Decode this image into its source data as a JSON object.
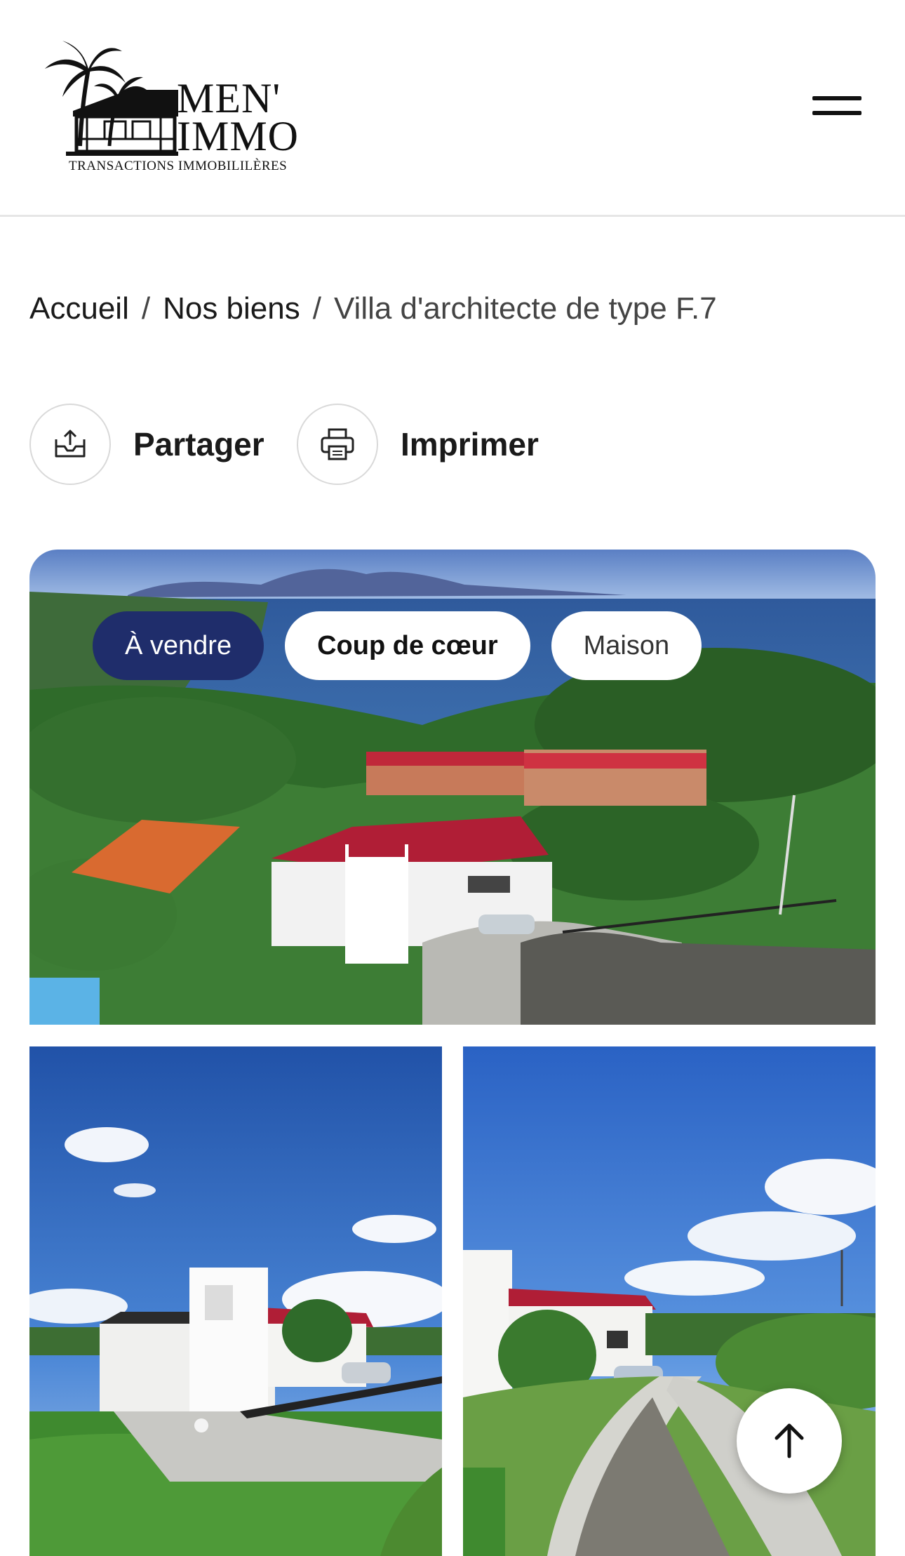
{
  "header": {
    "logo": {
      "name_line1": "MEN'",
      "name_line2": "IMMO",
      "tagline": "TRANSACTIONS IMMOBILILÈRES"
    },
    "menu_icon": "hamburger-menu-icon"
  },
  "breadcrumb": {
    "items": [
      "Accueil",
      "Nos biens"
    ],
    "separator": "/",
    "current": "Villa d'architecte de type F.7"
  },
  "actions": {
    "share_label": "Partager",
    "share_icon": "share-icon",
    "print_label": "Imprimer",
    "print_icon": "printer-icon"
  },
  "gallery": {
    "badges": {
      "status": "À vendre",
      "highlight": "Coup de cœur",
      "type": "Maison"
    },
    "colors": {
      "status_badge_bg": "#1f2d6b",
      "badge_bg": "#ffffff"
    }
  },
  "scroll_top_icon": "arrow-up-icon"
}
